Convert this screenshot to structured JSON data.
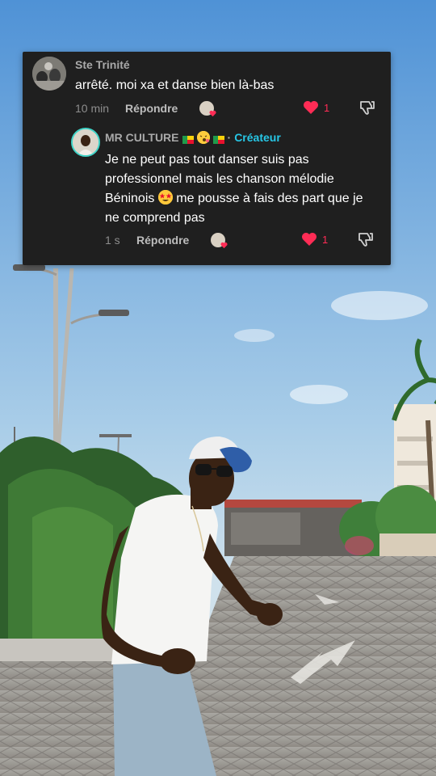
{
  "comments": [
    {
      "username": "Ste Trinité",
      "text": "arrêté. moi xa et danse bien là-bas",
      "time": "10 min",
      "reply_label": "Répondre",
      "likes": "1"
    },
    {
      "username": "MR CULTURE",
      "creator_badge": "Créateur",
      "separator": "·",
      "text_before_emoji": "Je ne peut pas tout danser suis pas professionnel mais les chanson mélodie Béninois",
      "text_after_emoji": " me pousse à fais des part que je ne comprend pas",
      "time": "1 s",
      "reply_label": "Répondre",
      "likes": "1"
    }
  ],
  "colors": {
    "card_bg": "#1f1f1f",
    "like_red": "#ff2c55",
    "creator_cyan": "#27c7e6",
    "avatar_ring": "#3fd4c8"
  },
  "icons": [
    "heart-icon",
    "dislike-icon",
    "flag-icon",
    "emoji-icon"
  ]
}
